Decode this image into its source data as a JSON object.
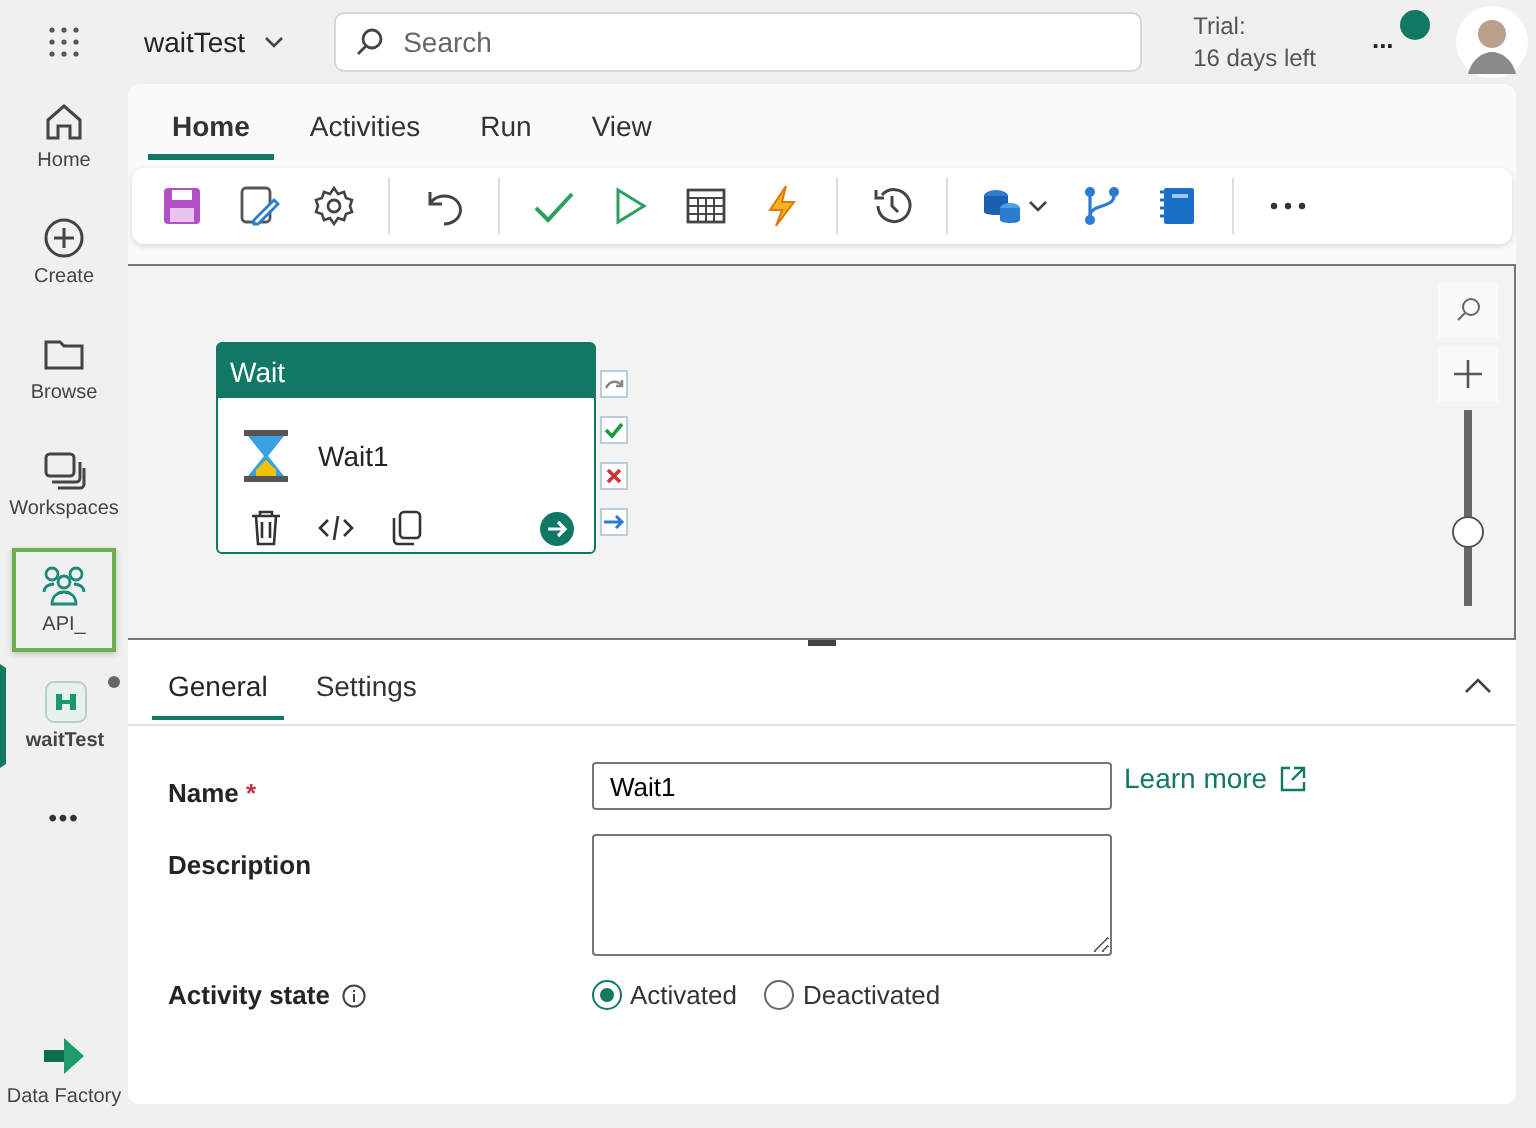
{
  "header": {
    "workspace": "waitTest",
    "search": {
      "placeholder": "Search"
    },
    "trial_label": "Trial:",
    "trial_days": "16 days left",
    "more": "...",
    "presence_online": true
  },
  "nav": [
    {
      "kind": "home",
      "label": "Home",
      "selected": false,
      "highlighted": false,
      "unsaved": false
    },
    {
      "kind": "create",
      "label": "Create",
      "selected": false,
      "highlighted": false,
      "unsaved": false
    },
    {
      "kind": "browse",
      "label": "Browse",
      "selected": false,
      "highlighted": false,
      "unsaved": false
    },
    {
      "kind": "workspaces",
      "label": "Workspaces",
      "selected": false,
      "highlighted": false,
      "unsaved": false
    },
    {
      "kind": "people",
      "label": "API_",
      "selected": false,
      "highlighted": true,
      "unsaved": false
    },
    {
      "kind": "pipeline",
      "label": "waitTest",
      "selected": true,
      "highlighted": false,
      "unsaved": true
    },
    {
      "kind": "more",
      "label": "•••",
      "selected": false,
      "highlighted": false,
      "unsaved": false
    }
  ],
  "product": "Data Factory",
  "ribbon_tabs": [
    {
      "label": "Home",
      "selected": true
    },
    {
      "label": "Activities",
      "selected": false
    },
    {
      "label": "Run",
      "selected": false
    },
    {
      "label": "View",
      "selected": false
    }
  ],
  "toolbar": [
    {
      "kind": "save"
    },
    {
      "kind": "edit"
    },
    {
      "kind": "gear"
    },
    {
      "kind": "sep"
    },
    {
      "kind": "undo"
    },
    {
      "kind": "sep"
    },
    {
      "kind": "check"
    },
    {
      "kind": "play"
    },
    {
      "kind": "calendar"
    },
    {
      "kind": "bolt"
    },
    {
      "kind": "sep"
    },
    {
      "kind": "history"
    },
    {
      "kind": "sep"
    },
    {
      "kind": "database"
    },
    {
      "kind": "branch"
    },
    {
      "kind": "notebook"
    },
    {
      "kind": "sep"
    },
    {
      "kind": "ellipsis"
    }
  ],
  "activity": {
    "type": "Wait",
    "name": "Wait1"
  },
  "zoom": {
    "level": 0.35
  },
  "panel_tabs": [
    {
      "label": "General",
      "selected": true
    },
    {
      "label": "Settings",
      "selected": false
    }
  ],
  "form": {
    "name_label": "Name",
    "required_mark": "*",
    "name_value": "Wait1",
    "learn_more": "Learn more",
    "description_label": "Description",
    "state_label": "Activity state",
    "states": [
      {
        "label": "Activated",
        "selected": true
      },
      {
        "label": "Deactivated",
        "selected": false
      }
    ]
  }
}
